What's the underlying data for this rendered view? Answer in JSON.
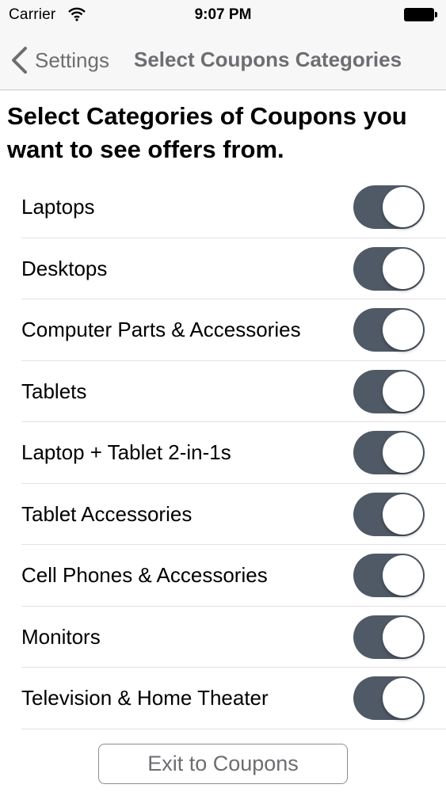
{
  "status_bar": {
    "carrier": "Carrier",
    "time": "9:07 PM",
    "wifi_icon": "wifi-icon",
    "battery_icon": "battery-icon"
  },
  "nav": {
    "back_label": "Settings",
    "back_icon": "chevron-left-icon",
    "title": "Select Coupons Categories"
  },
  "heading": "Select Categories of Coupons you want to see offers from.",
  "categories": [
    {
      "label": "Laptops",
      "enabled": true
    },
    {
      "label": "Desktops",
      "enabled": true
    },
    {
      "label": "Computer Parts & Accessories",
      "enabled": true
    },
    {
      "label": "Tablets",
      "enabled": true
    },
    {
      "label": "Laptop + Tablet 2-in-1s",
      "enabled": true
    },
    {
      "label": "Tablet Accessories",
      "enabled": true
    },
    {
      "label": "Cell Phones & Accessories",
      "enabled": true
    },
    {
      "label": "Monitors",
      "enabled": true
    },
    {
      "label": "Television & Home Theater",
      "enabled": true
    }
  ],
  "exit_button": "Exit to Coupons",
  "colors": {
    "toggle_on": "#505a66",
    "nav_text": "#6d6d72",
    "bar_background": "#f7f7f7"
  }
}
